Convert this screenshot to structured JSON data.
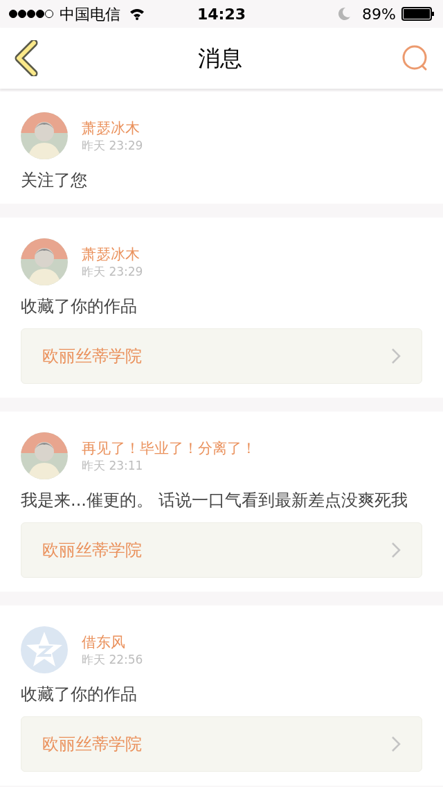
{
  "status_bar": {
    "carrier": "中国电信",
    "time": "14:23",
    "battery": "89%"
  },
  "header": {
    "title": "消息"
  },
  "messages": [
    {
      "name": "萧瑟冰木",
      "time": "昨天 23:29",
      "text": "关注了您"
    },
    {
      "name": "萧瑟冰木",
      "time": "昨天 23:29",
      "text": "收藏了你的作品",
      "work": "欧丽丝蒂学院"
    },
    {
      "name": "再见了！毕业了！分离了！",
      "time": "昨天 23:11",
      "text": "我是来...催更的。 话说一口气看到最新差点没爽死我",
      "work": "欧丽丝蒂学院"
    },
    {
      "avatar": {
        "kind": "default"
      },
      "name": "借东风",
      "time": "昨天 22:56",
      "text": "收藏了你的作品",
      "work": "欧丽丝蒂学院"
    }
  ]
}
